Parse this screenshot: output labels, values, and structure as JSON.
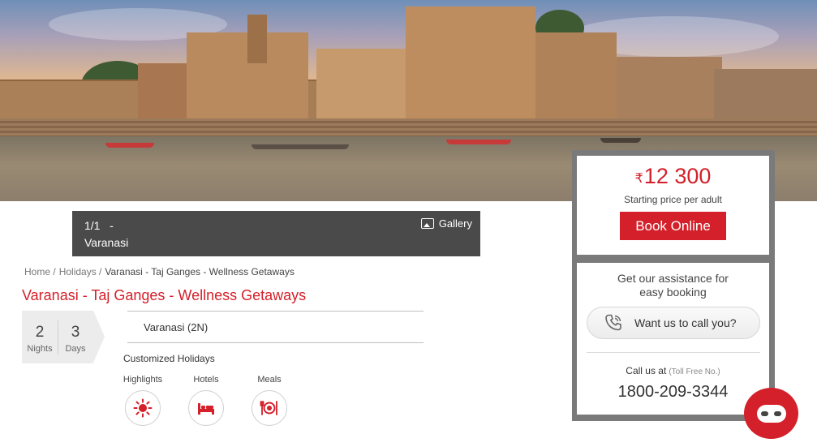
{
  "gallery": {
    "counter": "1/1   -",
    "city": "Varanasi",
    "button_label": "Gallery"
  },
  "breadcrumb": {
    "home": "Home /",
    "holidays": "Holidays /",
    "current": "Varanasi - Taj Ganges - Wellness Getaways"
  },
  "package": {
    "title": "Varanasi - Taj Ganges - Wellness Getaways",
    "nights_value": "2",
    "nights_label": "Nights",
    "days_value": "3",
    "days_label": "Days",
    "route": "Varanasi (2N)",
    "type": "Customized Holidays",
    "features": [
      {
        "label": "Highlights",
        "icon": "sun-icon"
      },
      {
        "label": "Hotels",
        "icon": "bed-icon"
      },
      {
        "label": "Meals",
        "icon": "fork-plate-knife-icon"
      }
    ]
  },
  "booking": {
    "currency": "₹",
    "price": "12 300",
    "price_note": "Starting price per adult",
    "book_label": "Book Online",
    "assist_line1": "Get our assistance for",
    "assist_line2": "easy booking",
    "callback_label": "Want us to call you?",
    "call_us": "Call us at",
    "toll_free": "(Toll Free No.)",
    "phone": "1800-209-3344"
  },
  "colors": {
    "accent": "#d4202a",
    "gallery_bar": "#4a4a4a",
    "panel_border": "#7a7a7a"
  }
}
